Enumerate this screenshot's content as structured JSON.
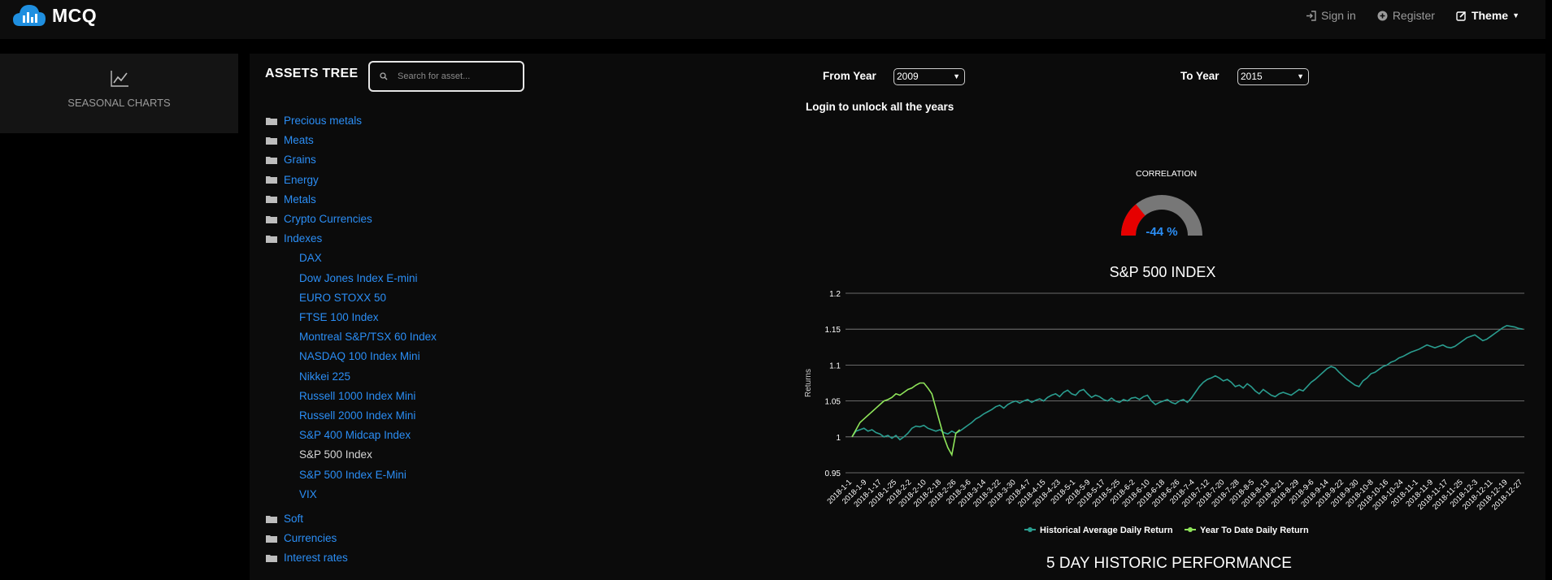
{
  "header": {
    "logo_text": "MCQ",
    "signin_label": "Sign in",
    "register_label": "Register",
    "theme_label": "Theme"
  },
  "sidebar": {
    "seasonal_label": "SEASONAL CHARTS"
  },
  "assets": {
    "title": "ASSETS TREE",
    "search_placeholder": "Search for asset...",
    "folders_top": [
      "Precious metals",
      "Meats",
      "Grains",
      "Energy",
      "Metals",
      "Crypto Currencies",
      "Indexes"
    ],
    "index_children": [
      "DAX",
      "Dow Jones Index E-mini",
      "EURO STOXX 50",
      "FTSE 100 Index",
      "Montreal S&P/TSX 60 Index",
      "NASDAQ 100 Index Mini",
      "Nikkei 225",
      "Russell 1000 Index Mini",
      "Russell 2000 Index Mini",
      "S&P 400 Midcap Index",
      "S&P 500 Index",
      "S&P 500 Index E-Mini",
      "VIX"
    ],
    "active_child": "S&P 500 Index",
    "folders_bottom": [
      "Soft",
      "Currencies",
      "Interest rates"
    ]
  },
  "controls": {
    "from_label": "From Year",
    "from_value": "2009",
    "to_label": "To Year",
    "to_value": "2015",
    "login_note": "Login to unlock all the years"
  },
  "correlation": {
    "title": "CORRELATION",
    "value_text": "-44 %",
    "value": -44,
    "colors": {
      "negative": "#e60000",
      "track": "#777777",
      "text": "#2b8ef5"
    }
  },
  "chart_data": {
    "type": "line",
    "title": "S&P 500 INDEX",
    "ylabel": "Returns",
    "xlabel": "",
    "ylim": [
      0.95,
      1.2
    ],
    "yticks": [
      0.95,
      1,
      1.05,
      1.1,
      1.15,
      1.2
    ],
    "x_ticks": [
      "2018-1-1",
      "2018-1-9",
      "2018-1-17",
      "2018-1-25",
      "2018-2-2",
      "2018-2-10",
      "2018-2-18",
      "2018-2-26",
      "2018-3-6",
      "2018-3-14",
      "2018-3-22",
      "2018-3-30",
      "2018-4-7",
      "2018-4-15",
      "2018-4-23",
      "2018-5-1",
      "2018-5-9",
      "2018-5-17",
      "2018-5-25",
      "2018-6-2",
      "2018-6-10",
      "2018-6-18",
      "2018-6-26",
      "2018-7-4",
      "2018-7-12",
      "2018-7-20",
      "2018-7-28",
      "2018-8-5",
      "2018-8-13",
      "2018-8-21",
      "2018-8-29",
      "2018-9-6",
      "2018-9-14",
      "2018-9-22",
      "2018-9-30",
      "2018-10-8",
      "2018-10-16",
      "2018-10-24",
      "2018-11-1",
      "2018-11-9",
      "2018-11-17",
      "2018-11-25",
      "2018-12-3",
      "2018-12-11",
      "2018-12-19",
      "2018-12-27"
    ],
    "grid": true,
    "legend_placement": "bottom-center",
    "series": [
      {
        "name": "Historical Average Daily Return",
        "color": "#2a9d8f",
        "values": [
          1.0,
          1.008,
          1.01,
          1.012,
          1.008,
          1.01,
          1.006,
          1.004,
          1.0,
          1.002,
          0.998,
          1.002,
          0.996,
          1.0,
          1.005,
          1.012,
          1.015,
          1.014,
          1.016,
          1.012,
          1.01,
          1.008,
          1.01,
          1.006,
          1.004,
          1.008,
          1.005,
          1.008,
          1.012,
          1.016,
          1.02,
          1.025,
          1.028,
          1.032,
          1.035,
          1.038,
          1.042,
          1.044,
          1.04,
          1.045,
          1.048,
          1.05,
          1.047,
          1.05,
          1.052,
          1.048,
          1.051,
          1.053,
          1.05,
          1.055,
          1.058,
          1.06,
          1.056,
          1.062,
          1.065,
          1.06,
          1.058,
          1.064,
          1.066,
          1.06,
          1.055,
          1.058,
          1.056,
          1.052,
          1.05,
          1.054,
          1.05,
          1.048,
          1.052,
          1.05,
          1.054,
          1.055,
          1.052,
          1.056,
          1.058,
          1.05,
          1.045,
          1.048,
          1.05,
          1.052,
          1.048,
          1.046,
          1.05,
          1.052,
          1.048,
          1.054,
          1.062,
          1.07,
          1.076,
          1.08,
          1.082,
          1.085,
          1.082,
          1.078,
          1.08,
          1.076,
          1.07,
          1.072,
          1.068,
          1.074,
          1.07,
          1.064,
          1.06,
          1.066,
          1.062,
          1.058,
          1.056,
          1.06,
          1.062,
          1.06,
          1.058,
          1.062,
          1.066,
          1.064,
          1.07,
          1.076,
          1.08,
          1.085,
          1.09,
          1.095,
          1.098,
          1.096,
          1.09,
          1.085,
          1.08,
          1.076,
          1.072,
          1.07,
          1.078,
          1.082,
          1.088,
          1.09,
          1.094,
          1.098,
          1.1,
          1.104,
          1.106,
          1.11,
          1.112,
          1.115,
          1.118,
          1.12,
          1.122,
          1.125,
          1.128,
          1.126,
          1.124,
          1.126,
          1.128,
          1.125,
          1.124,
          1.126,
          1.13,
          1.134,
          1.138,
          1.14,
          1.142,
          1.138,
          1.134,
          1.136,
          1.14,
          1.144,
          1.148,
          1.152,
          1.155,
          1.154,
          1.153,
          1.151,
          1.15
        ]
      },
      {
        "name": "Year To Date Daily Return",
        "color": "#8fe55a",
        "values": [
          1.0,
          1.01,
          1.02,
          1.025,
          1.03,
          1.035,
          1.04,
          1.045,
          1.05,
          1.052,
          1.055,
          1.06,
          1.058,
          1.062,
          1.066,
          1.068,
          1.072,
          1.075,
          1.075,
          1.068,
          1.06,
          1.04,
          1.02,
          1.0,
          0.985,
          0.975,
          1.005,
          1.01
        ]
      }
    ]
  },
  "section2_title": "5 DAY HISTORIC PERFORMANCE"
}
